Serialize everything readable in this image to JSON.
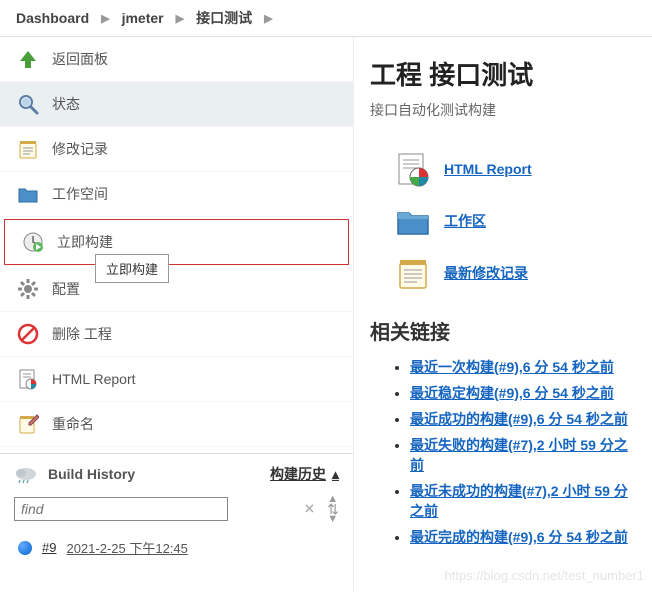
{
  "breadcrumb": {
    "items": [
      "Dashboard",
      "jmeter",
      "接口测试"
    ]
  },
  "sidebar": {
    "items": [
      {
        "label": "返回面板"
      },
      {
        "label": "状态"
      },
      {
        "label": "修改记录"
      },
      {
        "label": "工作空间"
      },
      {
        "label": "立即构建"
      },
      {
        "label": "配置"
      },
      {
        "label": "删除 工程"
      },
      {
        "label": "HTML Report"
      },
      {
        "label": "重命名"
      }
    ],
    "tooltip": "立即构建"
  },
  "build_history": {
    "title": "Build History",
    "link": "构建历史",
    "search_placeholder": "find",
    "builds": [
      {
        "num": "#9",
        "date": "2021-2-25 下午12:45"
      }
    ]
  },
  "main": {
    "title": "工程 接口测试",
    "subtitle": "接口自动化测试构建",
    "resources": [
      {
        "label": "HTML Report"
      },
      {
        "label": "工作区"
      },
      {
        "label": "最新修改记录"
      }
    ],
    "related_heading": "相关链接",
    "links": [
      "最近一次构建(#9),6 分 54 秒之前",
      "最近稳定构建(#9),6 分 54 秒之前",
      "最近成功的构建(#9),6 分 54 秒之前",
      "最近失败的构建(#7),2 小时 59 分之前",
      "最近未成功的构建(#7),2 小时 59 分之前",
      "最近完成的构建(#9),6 分 54 秒之前"
    ]
  },
  "watermark": "https://blog.csdn.net/test_number1"
}
